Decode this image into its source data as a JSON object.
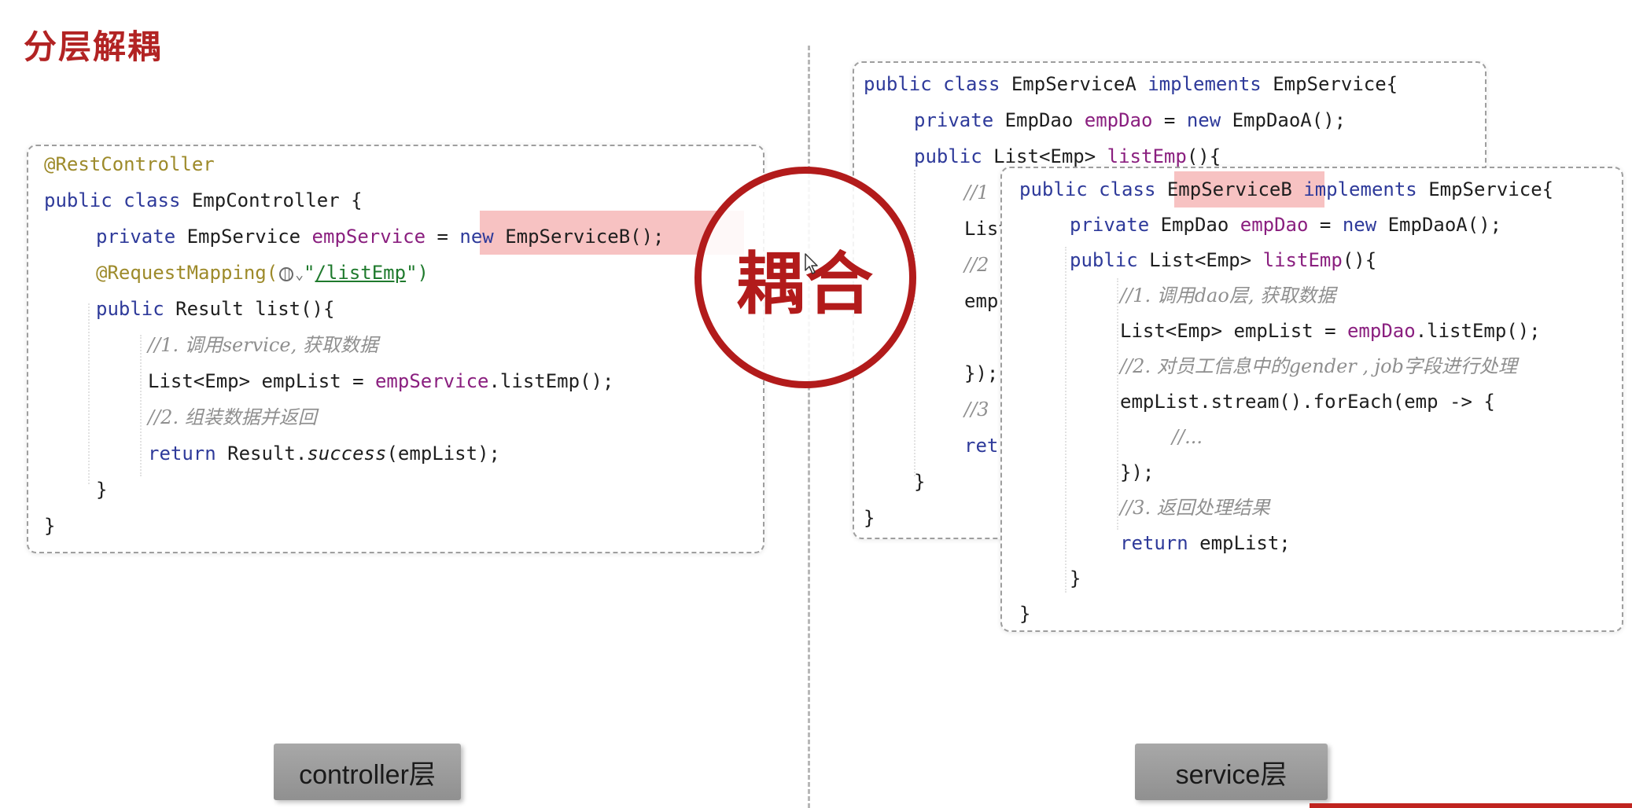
{
  "slide": {
    "title": "分层解耦",
    "coupling_text": "耦合",
    "controller_label": "controller层",
    "service_label": "service层"
  },
  "colors": {
    "title_red": "#b22323",
    "highlight_pink": "#f7c2c2",
    "keyword_blue": "#2e3a9a",
    "field_purple": "#8a1f7f",
    "annotation_olive": "#9d8a2a",
    "comment_gray": "#8f8f8f"
  },
  "icons": {
    "globe": "globe-icon",
    "chevron": "chevron-down-icon",
    "cursor": "mouse-cursor-icon"
  },
  "controller_code": {
    "l1_annotation": "@RestController",
    "l2_kw": "public class ",
    "l2_rest": "EmpController {",
    "l3_kw": "private ",
    "l3_type": "EmpService ",
    "l3_field": "empService",
    "l3_mid": " = ",
    "l3_new": "new ",
    "l3_end": "EmpServiceB();",
    "l4_annotation": "@RequestMapping(",
    "l4_str_open": "\"",
    "l4_str": "/listEmp",
    "l4_close": "\")",
    "l5_kw": "public ",
    "l5_rest": "Result list(){",
    "l6_comment": "//1. 调用service, 获取数据",
    "l7_pre": "List<Emp> empList = ",
    "l7_field": "empService",
    "l7_post": ".listEmp();",
    "l8_comment": "//2. 组装数据并返回",
    "l9_kw": "return ",
    "l9_pre": "Result.",
    "l9_italic": "success",
    "l9_post": "(empList);",
    "l10": "}",
    "l11": "}"
  },
  "service_a_code": {
    "l1_kw1": "public class ",
    "l1_name": "EmpServiceA ",
    "l1_kw2": "implements ",
    "l1_iface": "EmpService{",
    "l2_kw": "private ",
    "l2_type": "EmpDao ",
    "l2_field": "empDao",
    "l2_mid": " = ",
    "l2_new": "new ",
    "l2_end": "EmpDaoA();",
    "l3_kw": "public ",
    "l3_type": "List<Emp> ",
    "l3_method": "listEmp",
    "l3_end": "(){",
    "l4_comment": "//1",
    "l5": "List",
    "l6_comment": "//2",
    "l7": "emp",
    "l9": "});",
    "l10_comment": "//3",
    "l11_kw": "ret",
    "l12": "}",
    "l13": "}"
  },
  "service_b_code": {
    "l1_kw1": "public class ",
    "l1_name": "EmpServiceB",
    "l1_kw2": " implements ",
    "l1_iface": "EmpService{",
    "l2_kw": "private ",
    "l2_type": "EmpDao ",
    "l2_field": "empDao",
    "l2_mid": " = ",
    "l2_new": "new ",
    "l2_end": "EmpDaoA();",
    "l3_kw": "public ",
    "l3_type": "List<Emp> ",
    "l3_method": "listEmp",
    "l3_end": "(){",
    "l4_comment": "//1. 调用dao层, 获取数据",
    "l5_pre": "List<Emp> empList = ",
    "l5_field": "empDao",
    "l5_post": ".listEmp();",
    "l6_comment": "//2. 对员工信息中的gender , job字段进行处理",
    "l7": "empList.stream().forEach(emp -> {",
    "l8_comment": "//...",
    "l9": "});",
    "l10_comment": "//3. 返回处理结果",
    "l11_kw": "return ",
    "l11_rest": "empList;",
    "l12": "}",
    "l13": "}"
  }
}
